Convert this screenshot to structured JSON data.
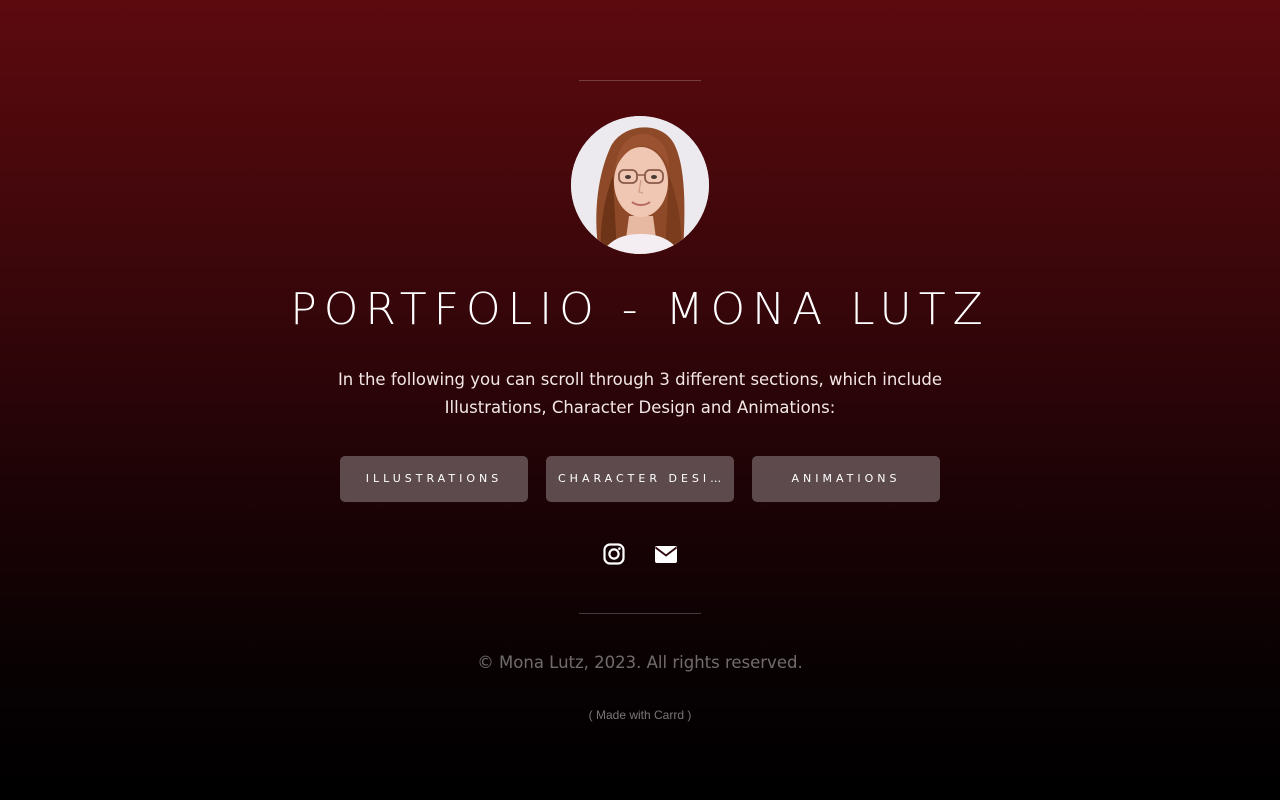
{
  "profile": {
    "title": "PORTFOLIO - MONA LUTZ",
    "intro": "In the following you can scroll through 3 different sections, which include Illustrations, Character Design and Animations:"
  },
  "buttons": [
    {
      "label": "ILLUSTRATIONS"
    },
    {
      "label": "CHARACTER DESIGN"
    },
    {
      "label": "ANIMATIONS"
    }
  ],
  "social": {
    "instagram_icon": "instagram-icon",
    "email_icon": "envelope-icon"
  },
  "footer": {
    "copyright": "© Mona Lutz, 2023. All rights reserved.",
    "made_with": "( Made with Carrd )"
  },
  "colors": {
    "background_top": "#5c0a0e",
    "background_bottom": "#000000",
    "button_bg": "#847678",
    "text": "#ffffff"
  }
}
